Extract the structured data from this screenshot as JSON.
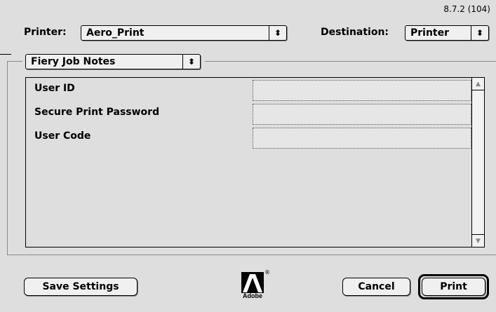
{
  "version": "8.7.2 (104)",
  "printer": {
    "label": "Printer:",
    "value": "Aero_Print"
  },
  "destination": {
    "label": "Destination:",
    "value": "Printer"
  },
  "section": {
    "value": "Fiery Job Notes"
  },
  "fields": [
    {
      "label": "User ID",
      "value": ""
    },
    {
      "label": "Secure Print Password",
      "value": ""
    },
    {
      "label": "User Code",
      "value": ""
    }
  ],
  "buttons": {
    "save_settings": "Save Settings",
    "cancel": "Cancel",
    "print": "Print"
  },
  "logo": {
    "text": "Adobe",
    "registered": "®"
  },
  "icons": {
    "popup_arrows": "up-down-arrows-icon",
    "scroll_up": "scroll-up-arrow-icon",
    "scroll_down": "scroll-down-arrow-icon",
    "logo": "adobe-logo"
  }
}
